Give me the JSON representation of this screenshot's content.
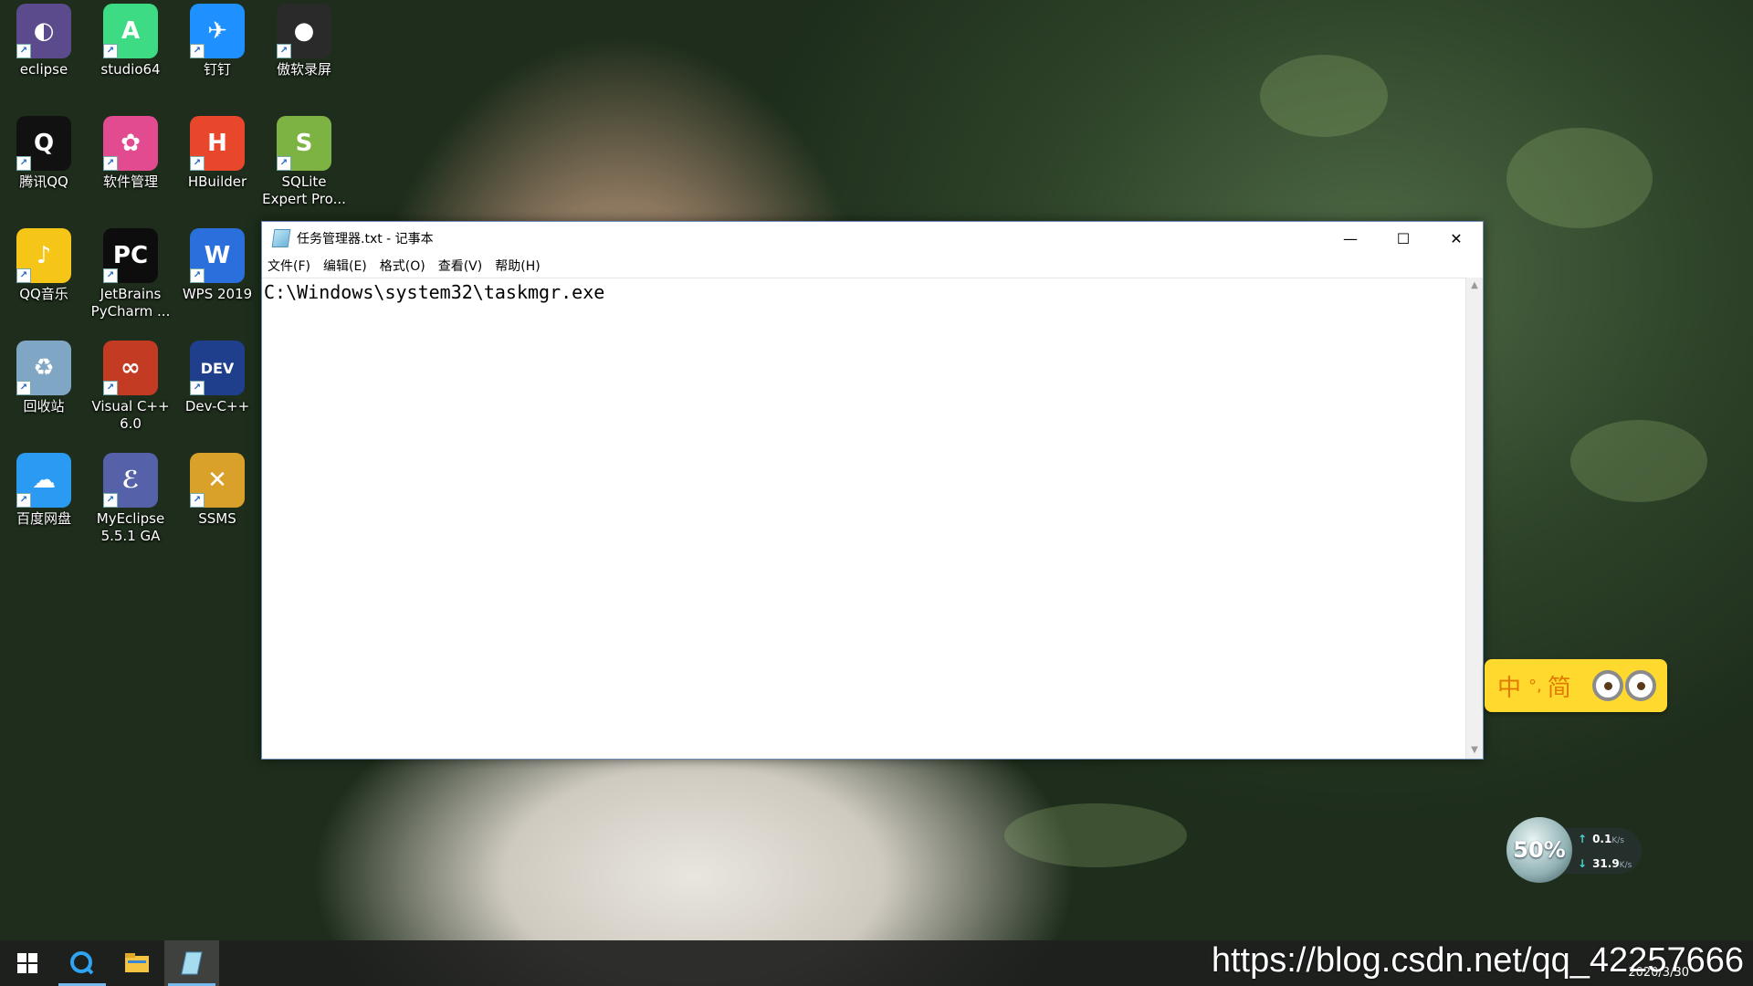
{
  "desktop": {
    "icons": [
      {
        "label": "eclipse",
        "color": "#5b4a8c",
        "glyph": "◐"
      },
      {
        "label": "studio64",
        "color": "#3ddc84",
        "glyph": "A"
      },
      {
        "label": "钉钉",
        "color": "#1e90ff",
        "glyph": "✈"
      },
      {
        "label": "傲软录屏",
        "color": "#2a2a2a",
        "glyph": "●"
      },
      {
        "label": "腾讯QQ",
        "color": "#111111",
        "glyph": "Q"
      },
      {
        "label": "软件管理",
        "color": "#e24b8f",
        "glyph": "✿"
      },
      {
        "label": "HBuilder",
        "color": "#e8472c",
        "glyph": "H"
      },
      {
        "label": "SQLite Expert Pro...",
        "color": "#7cb342",
        "glyph": "S"
      },
      {
        "label": "QQ音乐",
        "color": "#f5c518",
        "glyph": "♪"
      },
      {
        "label": "JetBrains PyCharm ...",
        "color": "#0d0d0d",
        "glyph": "PC"
      },
      {
        "label": "WPS 2019",
        "color": "#2a6fdb",
        "glyph": "W"
      },
      {
        "label": "回收站",
        "color": "#7fa6c4",
        "glyph": "♻"
      },
      {
        "label": "Visual C++ 6.0",
        "color": "#c23b22",
        "glyph": "∞"
      },
      {
        "label": "Dev-C++",
        "color": "#1f3e8c",
        "glyph": "DEV"
      },
      {
        "label": "百度网盘",
        "color": "#2b9af3",
        "glyph": "☁"
      },
      {
        "label": "MyEclipse 5.5.1 GA",
        "color": "#5561a8",
        "glyph": "ℰ"
      },
      {
        "label": "SSMS",
        "color": "#d9a12a",
        "glyph": "✕"
      }
    ]
  },
  "notepad": {
    "title": "任务管理器.txt - 记事本",
    "menu": [
      "文件(F)",
      "编辑(E)",
      "格式(O)",
      "查看(V)",
      "帮助(H)"
    ],
    "content": "C:\\Windows\\system32\\taskmgr.exe",
    "minimize_glyph": "—",
    "maximize_glyph": "☐",
    "close_glyph": "✕"
  },
  "ime": {
    "lang": "中",
    "punct": "°,",
    "mode": "简"
  },
  "network": {
    "percent": "50%",
    "upload": "0.1",
    "download": "31.9",
    "unit": "K/s"
  },
  "taskbar": {
    "date": "2020/3/30",
    "watermark": "https://blog.csdn.net/qq_42257666"
  }
}
